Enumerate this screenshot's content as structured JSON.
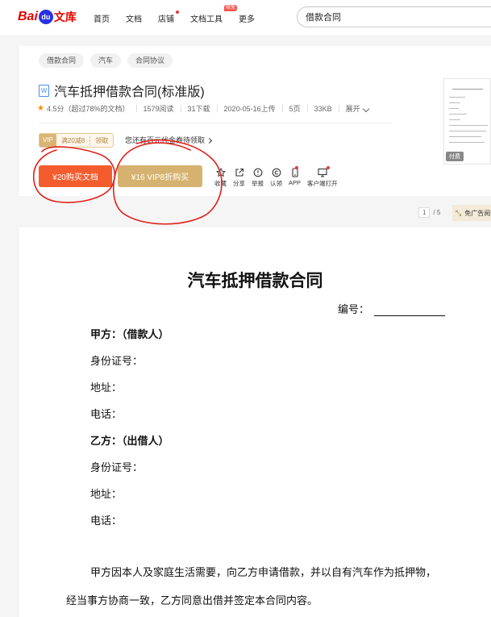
{
  "nav": {
    "logo_bai": "Bai",
    "logo_du": "du",
    "logo_wenku": "文库",
    "items": [
      {
        "label": "首页"
      },
      {
        "label": "文档"
      },
      {
        "label": "店铺"
      },
      {
        "label": "文档工具",
        "badge": "限免"
      },
      {
        "label": "更多"
      }
    ],
    "search_value": "借款合同"
  },
  "doc_header": {
    "tags": [
      "借款合同",
      "汽车",
      "合同协议"
    ],
    "file_icon": "W",
    "title": "汽车抵押借款合同(标准版)",
    "rating": "4.5分（超过78%的文档）",
    "reads": "1579阅读",
    "downloads": "31下载",
    "uploaded": "2020-05-16上传",
    "pages": "5页",
    "size": "33KB",
    "expand": "展开",
    "vip_coupon": {
      "vip": "VIP",
      "amount": "满20减8",
      "claim": "领取"
    },
    "coupon_tip": "您还有百元代金券待领取",
    "buy_label": "¥20购买文档",
    "vip_buy_label": "¥16 VIP8折购买",
    "actions": [
      "收藏",
      "分享",
      "举报",
      "认领",
      "APP",
      "客户端打开"
    ],
    "thumb_badge": "付费"
  },
  "pager": {
    "current": "1",
    "total": "/ 5",
    "free_read": "免广告阅读"
  },
  "document": {
    "title": "汽车抵押借款合同",
    "number_label": "编号：",
    "party_a": "甲方：（借款人）",
    "id_a": "身份证号：",
    "addr_a": "地址：",
    "tel_a": "电话：",
    "party_b": "乙方：（出借人）",
    "id_b": "身份证号：",
    "addr_b": "地址：",
    "tel_b": "电话：",
    "para1": "甲方因本人及家庭生活需要，向乙方申请借款，并以自有汽车作为抵押物，",
    "para2": "经当事方协商一致，乙方同意出借并签定本合同内容。"
  },
  "colors": {
    "accent_red": "#f45c2d",
    "vip_gold": "#d5b26f",
    "marker_red": "#e0201b"
  }
}
